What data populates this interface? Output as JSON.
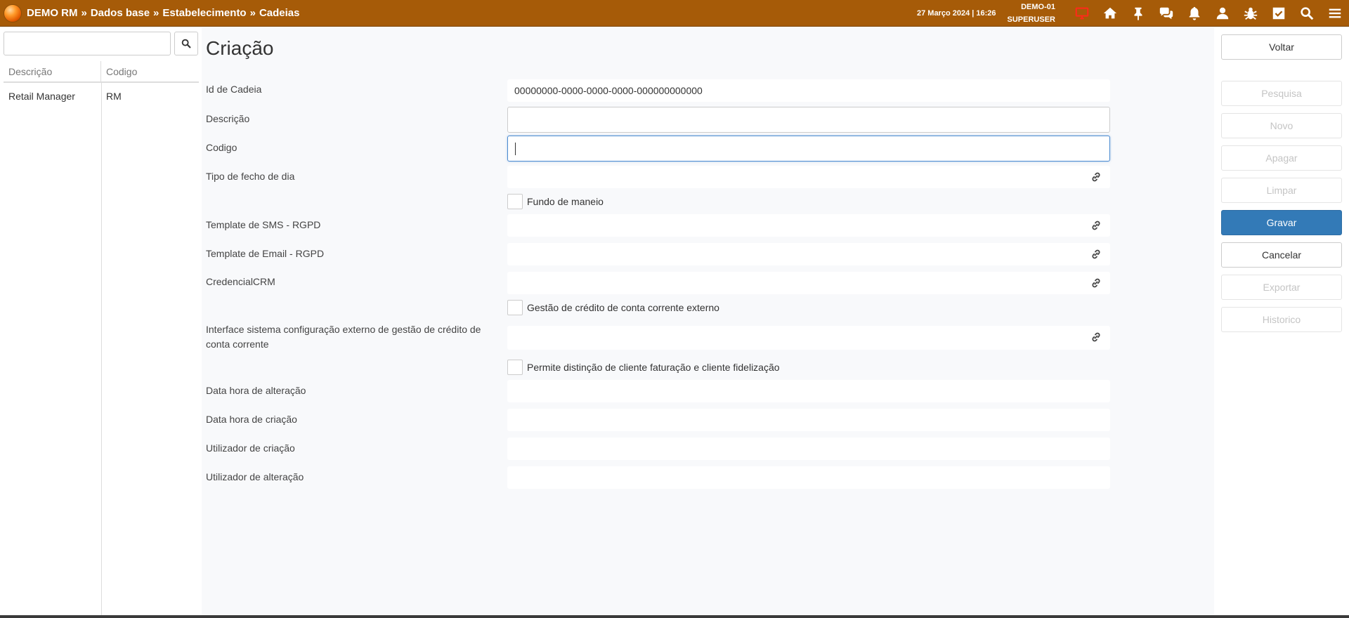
{
  "topbar": {
    "app_name": "DEMO RM",
    "breadcrumb": [
      "Dados base",
      "Estabelecimento",
      "Cadeias"
    ],
    "separator": "»",
    "datetime": "27 Março 2024 | 16:26",
    "company": "DEMO-01",
    "user": "SUPERUSER",
    "monitor_color": "#ff2a1a",
    "icons": [
      "monitor-icon",
      "home-icon",
      "pin-icon",
      "chat-icon",
      "bell-icon",
      "user-icon",
      "bug-icon",
      "checklist-icon",
      "search-icon",
      "menu-icon"
    ]
  },
  "left_panel": {
    "search": {
      "value": "",
      "placeholder": ""
    },
    "columns": [
      "Descrição",
      "Codigo"
    ],
    "rows": [
      {
        "descricao": "Retail Manager",
        "codigo": "RM"
      }
    ]
  },
  "form": {
    "title": "Criação",
    "fields": {
      "id_cadeia": {
        "label": "Id de Cadeia",
        "value": "00000000-0000-0000-0000-000000000000"
      },
      "descricao": {
        "label": "Descrição",
        "value": ""
      },
      "codigo": {
        "label": "Codigo",
        "value": ""
      },
      "tipo_fecho": {
        "label": "Tipo de fecho de dia",
        "value": ""
      },
      "template_sms": {
        "label": "Template de SMS - RGPD",
        "value": ""
      },
      "template_email": {
        "label": "Template de Email - RGPD",
        "value": ""
      },
      "credencial_crm": {
        "label": "CredencialCRM",
        "value": ""
      },
      "interface_sistema": {
        "label": "Interface sistema configuração externo de gestão de crédito de conta corrente",
        "value": ""
      },
      "data_alteracao": {
        "label": "Data hora de alteração",
        "value": ""
      },
      "data_criacao": {
        "label": "Data hora de criação",
        "value": ""
      },
      "utilizador_criacao": {
        "label": "Utilizador de criação",
        "value": ""
      },
      "utilizador_alteracao": {
        "label": "Utilizador de alteração",
        "value": ""
      }
    },
    "checkboxes": {
      "fundo_maneio": {
        "label": "Fundo de maneio",
        "checked": false
      },
      "gestao_credito": {
        "label": "Gestão de crédito de conta corrente externo",
        "checked": false
      },
      "distincao_cliente": {
        "label": "Permite distinção de cliente faturação e cliente fidelização",
        "checked": false
      }
    }
  },
  "actions": {
    "voltar": "Voltar",
    "pesquisa": "Pesquisa",
    "novo": "Novo",
    "apagar": "Apagar",
    "limpar": "Limpar",
    "gravar": "Gravar",
    "cancelar": "Cancelar",
    "exportar": "Exportar",
    "historico": "Historico",
    "primary_color": "#337ab7"
  }
}
